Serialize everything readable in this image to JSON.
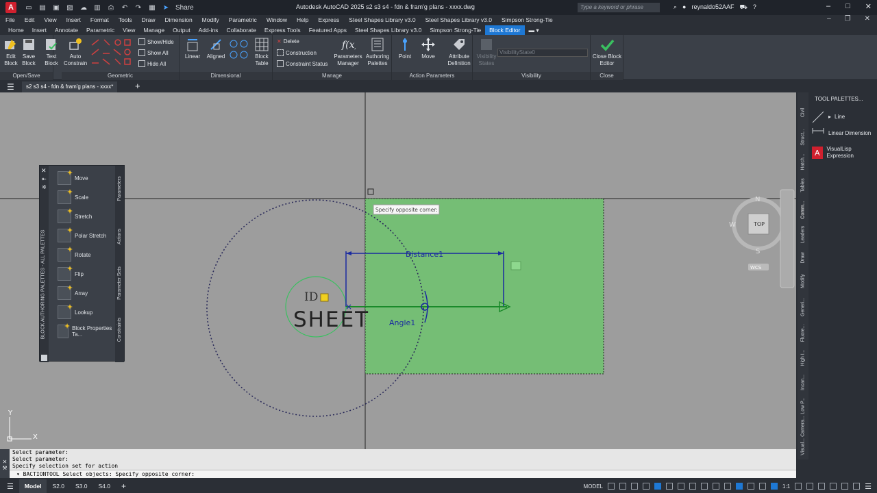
{
  "titlebar": {
    "logo": "A",
    "share_label": "Share",
    "title": "Autodesk AutoCAD 2025    s2 s3 s4 - fdn & fram'g plans - xxxx.dwg",
    "search_placeholder": "Type a keyword or phrase",
    "user": "reynaldo52AAF"
  },
  "menu": [
    "File",
    "Edit",
    "View",
    "Insert",
    "Format",
    "Tools",
    "Draw",
    "Dimension",
    "Modify",
    "Parametric",
    "Window",
    "Help",
    "Express",
    "Steel Shapes Library v3.0",
    "Steel Shapes Library v3.0",
    "Simpson Strong-Tie"
  ],
  "ribbon_tabs": [
    "Home",
    "Insert",
    "Annotate",
    "Parametric",
    "View",
    "Manage",
    "Output",
    "Add-ins",
    "Collaborate",
    "Express Tools",
    "Featured Apps",
    "Steel Shapes Library v3.0",
    "Simpson Strong-Tie",
    "Block Editor"
  ],
  "ribbon": {
    "openSave": {
      "title": "Open/Save",
      "edit_block": "Edit Block",
      "save_block": "Save Block",
      "test_block": "Test Block"
    },
    "geometric": {
      "title": "Geometric",
      "auto_constrain": "Auto Constrain",
      "show_hide": "Show/Hide",
      "show_all": "Show All",
      "hide_all": "Hide All"
    },
    "dimensional": {
      "title": "Dimensional",
      "linear": "Linear",
      "aligned": "Aligned",
      "block_table": "Block Table"
    },
    "manage": {
      "title": "Manage",
      "delete": "Delete",
      "construction": "Construction",
      "constraint_status": "Constraint Status",
      "parameters_manager": "Parameters Manager",
      "authoring_palettes": "Authoring Palettes"
    },
    "action": {
      "title": "Action Parameters",
      "point": "Point",
      "move": "Move",
      "attribute_definition": "Attribute Definition"
    },
    "visibility": {
      "title": "Visibility",
      "visibility_states": "Visibility States",
      "state_value": "VisibilityState0"
    },
    "close": {
      "title": "Close",
      "close_block_editor": "Close Block Editor"
    }
  },
  "file_tab": "s2 s3 s4 - fdn & fram'g plans - xxxx*",
  "canvas": {
    "tooltip": "Specify opposite corner:",
    "distance_label": "Distance1",
    "angle_label": "Angle1",
    "id_text": "ID",
    "sheet_text": "SHEET",
    "viewcube": {
      "n": "N",
      "s": "S",
      "e": "E",
      "w": "W",
      "top": "TOP",
      "wcs": "WCS"
    },
    "ucs_y": "Y",
    "ucs_x": "X"
  },
  "block_palette": {
    "side_title": "BLOCK AUTHORING PALETTES - ALL PALETTES",
    "items": [
      "Move",
      "Scale",
      "Stretch",
      "Polar Stretch",
      "Rotate",
      "Flip",
      "Array",
      "Lookup",
      "Block Properties  Ta..."
    ],
    "tabs": [
      "Parameters",
      "Actions",
      "Parameter Sets",
      "Constraints"
    ]
  },
  "tool_palette": {
    "title": "TOOL PALETTES...",
    "items": [
      "Line",
      "Linear Dimension",
      "VisualLisp Expression"
    ],
    "tabs": [
      "Civil",
      "Struct...",
      "Hatch...",
      "Tables",
      "Comm...",
      "Leaders",
      "Draw",
      "Modify",
      "Generi...",
      "Fluore...",
      "High I...",
      "Incan...",
      "Low P...",
      "Camera...",
      "Visual..."
    ]
  },
  "command": {
    "history": [
      "Select parameter:",
      "Select parameter:",
      "Specify selection set for action"
    ],
    "prompt": "BACTIONTOOL Select objects: Specify opposite corner:"
  },
  "status": {
    "tabs": [
      "Model",
      "S2.0",
      "S3.0",
      "S4.0"
    ],
    "model_label": "MODEL",
    "scale": "1:1"
  }
}
